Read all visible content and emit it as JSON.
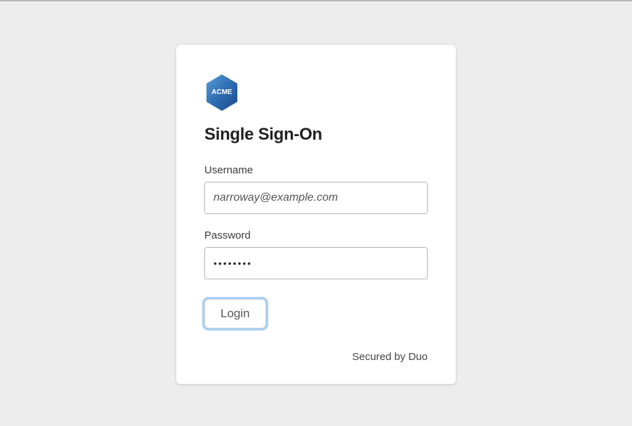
{
  "logo": {
    "text": "ACME",
    "name": "acme-logo"
  },
  "title": "Single Sign-On",
  "form": {
    "username": {
      "label": "Username",
      "value": "narroway@example.com"
    },
    "password": {
      "label": "Password",
      "value": "••••••••"
    },
    "submit_label": "Login"
  },
  "footer": "Secured by Duo"
}
